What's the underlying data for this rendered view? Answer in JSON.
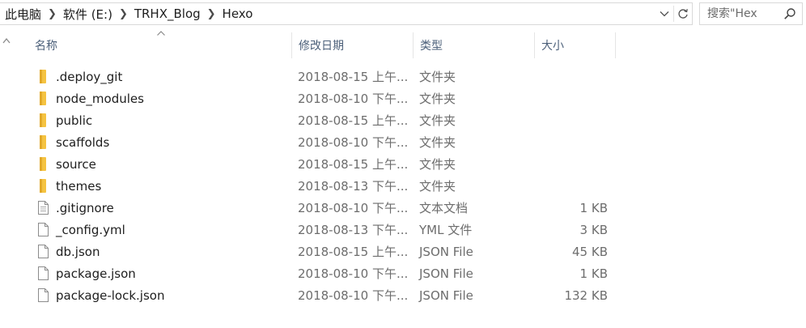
{
  "address_bar": {
    "breadcrumbs": [
      "此电脑",
      "软件 (E:)",
      "TRHX_Blog",
      "Hexo"
    ],
    "separator_icon": "chevron-right-icon",
    "dropdown_icon": "chevron-down-icon",
    "refresh_icon": "refresh-icon"
  },
  "search": {
    "placeholder": "搜索\"Hex",
    "icon": "search-icon"
  },
  "columns": {
    "name": "名称",
    "date_modified": "修改日期",
    "type": "类型",
    "size": "大小"
  },
  "sort": {
    "column": "name",
    "direction": "ascending"
  },
  "files": [
    {
      "name": ".deploy_git",
      "date": "2018-08-15 上午...",
      "type": "文件夹",
      "size": "",
      "icon": "folder-icon"
    },
    {
      "name": "node_modules",
      "date": "2018-08-10 下午...",
      "type": "文件夹",
      "size": "",
      "icon": "folder-icon"
    },
    {
      "name": "public",
      "date": "2018-08-15 上午...",
      "type": "文件夹",
      "size": "",
      "icon": "folder-icon"
    },
    {
      "name": "scaffolds",
      "date": "2018-08-10 下午...",
      "type": "文件夹",
      "size": "",
      "icon": "folder-icon"
    },
    {
      "name": "source",
      "date": "2018-08-15 上午...",
      "type": "文件夹",
      "size": "",
      "icon": "folder-icon"
    },
    {
      "name": "themes",
      "date": "2018-08-13 下午...",
      "type": "文件夹",
      "size": "",
      "icon": "folder-icon"
    },
    {
      "name": ".gitignore",
      "date": "2018-08-10 下午...",
      "type": "文本文档",
      "size": "1 KB",
      "icon": "text-file-icon"
    },
    {
      "name": "_config.yml",
      "date": "2018-08-13 下午...",
      "type": "YML 文件",
      "size": "3 KB",
      "icon": "file-icon"
    },
    {
      "name": "db.json",
      "date": "2018-08-15 上午...",
      "type": "JSON File",
      "size": "45 KB",
      "icon": "file-icon"
    },
    {
      "name": "package.json",
      "date": "2018-08-10 下午...",
      "type": "JSON File",
      "size": "1 KB",
      "icon": "file-icon"
    },
    {
      "name": "package-lock.json",
      "date": "2018-08-10 下午...",
      "type": "JSON File",
      "size": "132 KB",
      "icon": "file-icon"
    }
  ],
  "colors": {
    "folder": "#f5c341",
    "header_text": "#4c607a",
    "meta_text": "#6d6d6d",
    "border": "#d9d9d9"
  }
}
